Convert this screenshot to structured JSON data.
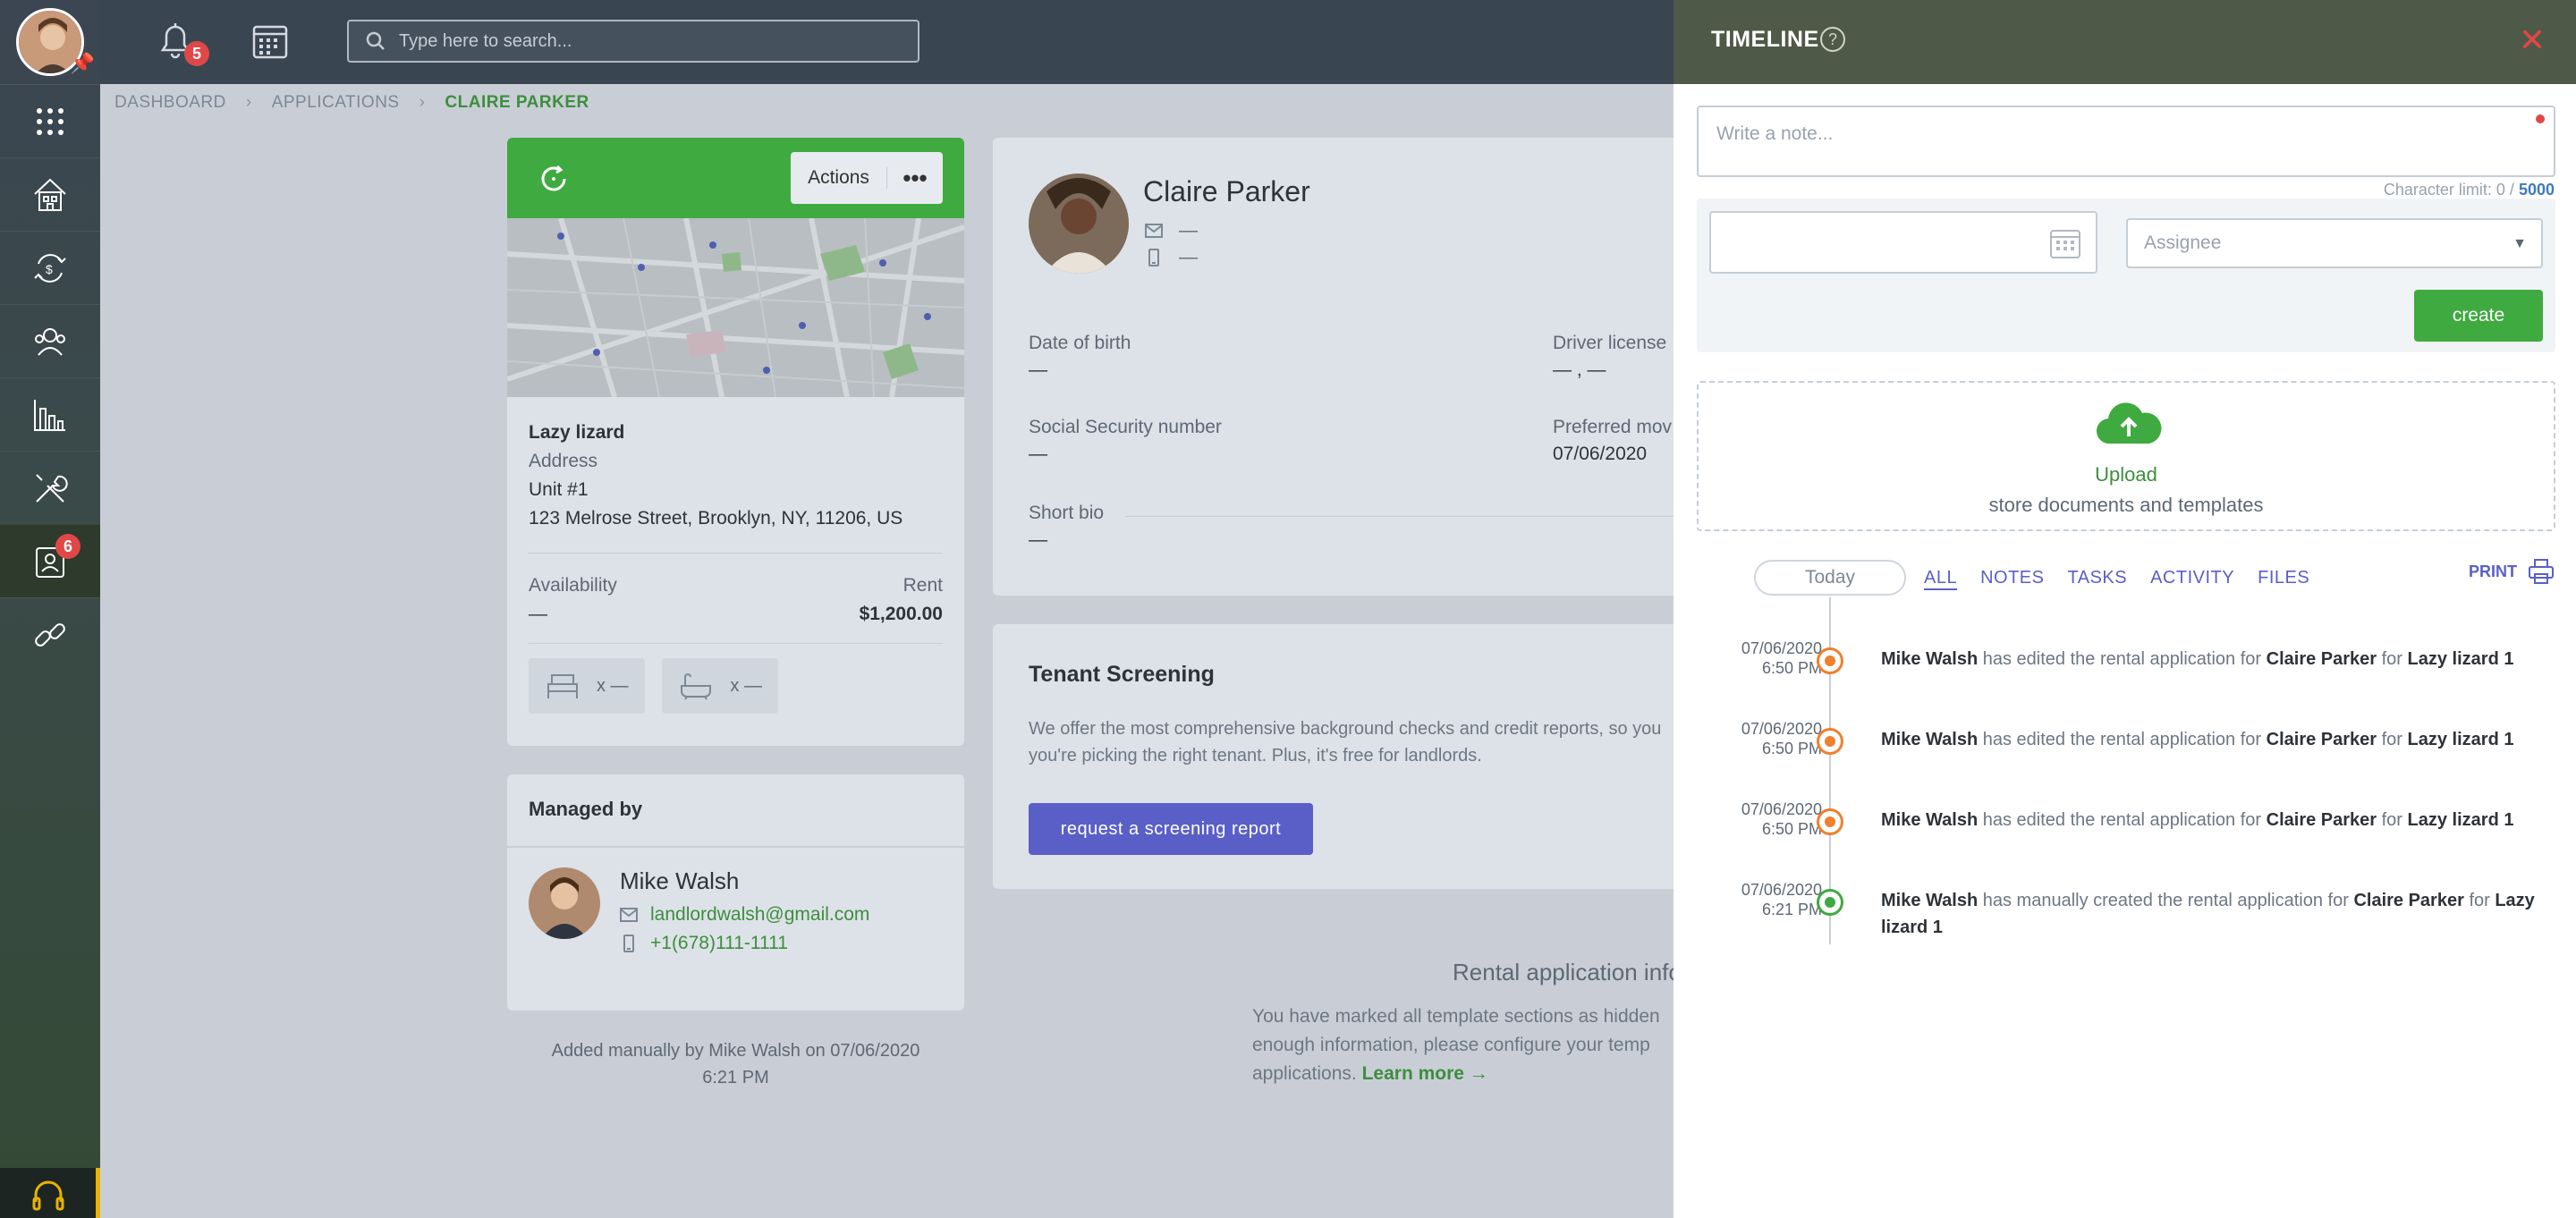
{
  "nav": {
    "bell_count": "5",
    "applications_count": "6"
  },
  "search": {
    "placeholder": "Type here to search..."
  },
  "breadcrumb": {
    "items": [
      "DASHBOARD",
      "APPLICATIONS",
      "CLAIRE PARKER"
    ]
  },
  "property": {
    "actions_label": "Actions",
    "name": "Lazy lizard",
    "address_label": "Address",
    "unit": "Unit #1",
    "street": "123 Melrose Street, Brooklyn, NY, 11206, US",
    "availability_label": "Availability",
    "availability_value": "—",
    "rent_label": "Rent",
    "rent_value": "$1,200.00",
    "beds": "x —",
    "baths": "x —"
  },
  "managed": {
    "title": "Managed by",
    "name": "Mike Walsh",
    "email": "landlordwalsh@gmail.com",
    "phone": "+1(678)111-1111",
    "added_line1": "Added manually by Mike Walsh on 07/06/2020",
    "added_line2": "6:21 PM"
  },
  "applicant": {
    "name": "Claire Parker",
    "email": "—",
    "phone": "—",
    "dob_label": "Date of birth",
    "dob_value": "—",
    "license_label": "Driver license",
    "license_value": "— , —",
    "ssn_label": "Social Security number",
    "ssn_value": "—",
    "move_label": "Preferred mov",
    "move_value": "07/06/2020",
    "bio_label": "Short bio",
    "bio_value": "—"
  },
  "screening": {
    "title": "Tenant Screening",
    "desc1": "We offer the most comprehensive background checks and credit reports, so you",
    "desc2": "you're picking the right tenant. Plus, it's free for landlords.",
    "button": "request a screening report"
  },
  "rental_info": {
    "title": "Rental application info",
    "line1": "You have marked all template sections as hidden",
    "line2": "enough information, please configure your temp",
    "line3": "applications.",
    "learn_more": "Learn more →"
  },
  "timeline": {
    "title": "TIMELINE",
    "help": "?",
    "note_placeholder": "Write a note...",
    "char_limit_label": "Character limit: 0 /",
    "char_limit_max": "5000",
    "assignee_placeholder": "Assignee",
    "create_label": "create",
    "upload_title": "Upload",
    "upload_sub": "store documents and templates",
    "today": "Today",
    "filters": [
      "ALL",
      "NOTES",
      "TASKS",
      "ACTIVITY",
      "FILES"
    ],
    "print": "PRINT",
    "entries": [
      {
        "date": "07/06/2020",
        "time": "6:50 PM",
        "actor": "Mike Walsh",
        "action": "has edited the rental application for",
        "target": "Claire Parker",
        "for": "for",
        "property": "Lazy lizard 1"
      },
      {
        "date": "07/06/2020",
        "time": "6:50 PM",
        "actor": "Mike Walsh",
        "action": "has edited the rental application for",
        "target": "Claire Parker",
        "for": "for",
        "property": "Lazy lizard 1"
      },
      {
        "date": "07/06/2020",
        "time": "6:50 PM",
        "actor": "Mike Walsh",
        "action": "has edited the rental application for",
        "target": "Claire Parker",
        "for": "for",
        "property": "Lazy lizard 1"
      },
      {
        "date": "07/06/2020",
        "time": "6:21 PM",
        "actor": "Mike Walsh",
        "action": "has manually created the rental application for",
        "target": "Claire Parker",
        "for": "for",
        "property": "Lazy lizard 1"
      }
    ]
  },
  "colors": {
    "accent_green": "#3faa3f",
    "accent_purple": "#5a5fc8",
    "badge_red": "#e04848",
    "activity_orange": "#f07f2e"
  }
}
